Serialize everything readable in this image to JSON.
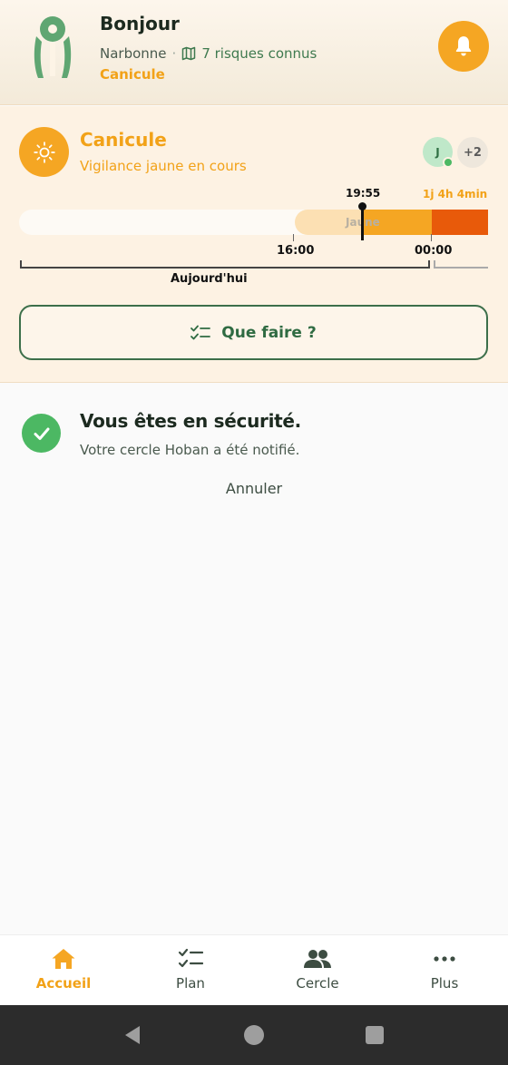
{
  "header": {
    "greeting": "Bonjour",
    "city": "Narbonne",
    "separator": "·",
    "risks_label": "7 risques connus",
    "active_alert": "Canicule"
  },
  "alert": {
    "title": "Canicule",
    "subtitle": "Vigilance jaune en cours",
    "avatar_initial": "J",
    "extra_members": "+2",
    "timeline": {
      "now_time": "19:55",
      "remaining": "1j 4h 4min",
      "segment_label": "Jaune",
      "tick_1": "16:00",
      "tick_2": "00:00",
      "day_label": "Aujourd'hui"
    },
    "action_button": "Que faire ?"
  },
  "safety": {
    "title": "Vous êtes en sécurité.",
    "subtitle": "Votre cercle Hoban a été notifié.",
    "cancel": "Annuler"
  },
  "nav": {
    "items": [
      {
        "label": "Accueil",
        "icon": "home-icon",
        "active": true
      },
      {
        "label": "Plan",
        "icon": "checklist-icon",
        "active": false
      },
      {
        "label": "Cercle",
        "icon": "people-icon",
        "active": false
      },
      {
        "label": "Plus",
        "icon": "more-icon",
        "active": false
      }
    ]
  },
  "colors": {
    "accent": "#f5a623",
    "orange_level": "#f5a623",
    "red_level": "#e85a0a",
    "green": "#4cb863",
    "dark_green": "#2f6b42"
  }
}
